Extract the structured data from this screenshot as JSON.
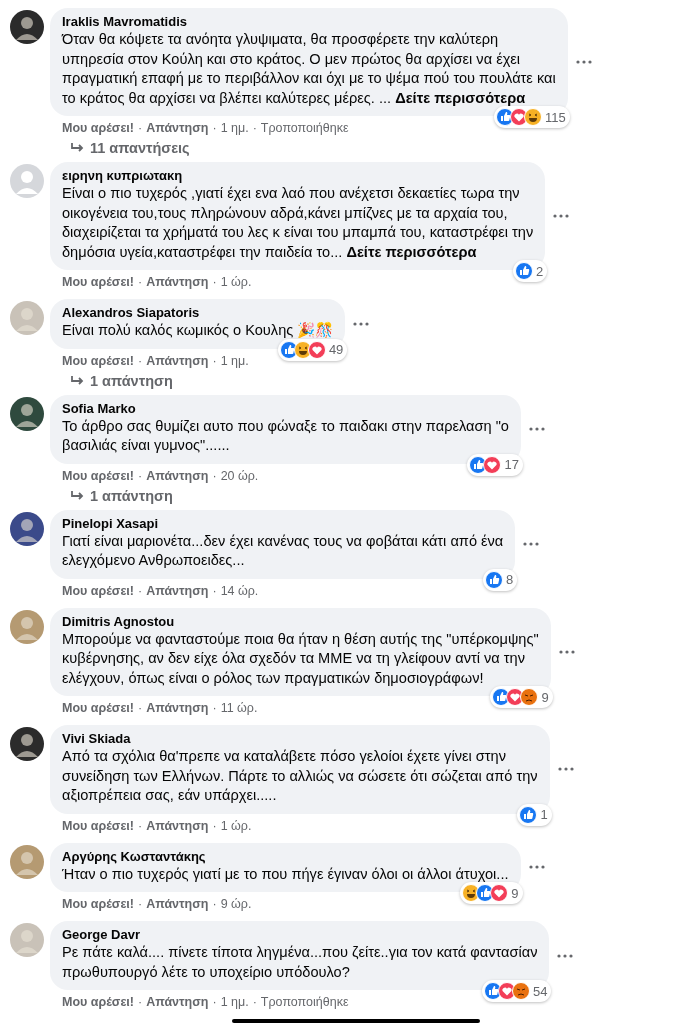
{
  "comments": [
    {
      "author": "Iraklis Mavromatidis",
      "lines": [
        "Όταν θα κόψετε τα ανόητα γλυψιματα, θα προσφέρετε την καλύτερη",
        "υπηρεσία στον Κούλη και στο κράτος. Ο μεν πρώτος θα αρχίσει να έχει",
        "πραγματική επαφή με το περιβάλλον και όχι με το ψέμα πού του πουλάτε και",
        "το κράτος θα αρχίσει να βλέπει καλύτερες μέρες. ... **Δείτε περισσότερα**"
      ],
      "actions": [
        {
          "kind": "like",
          "text": "Μου αρέσει!"
        },
        {
          "kind": "sep",
          "text": "·"
        },
        {
          "kind": "reply",
          "text": "Απάντηση"
        },
        {
          "kind": "sep",
          "text": "·"
        },
        {
          "kind": "meta",
          "text": "1 ημ."
        },
        {
          "kind": "sep",
          "text": "·"
        },
        {
          "kind": "meta",
          "text": "Τροποποιήθηκε"
        }
      ],
      "reactions": [
        {
          "kind": "like"
        },
        {
          "kind": "love"
        },
        {
          "kind": "haha"
        }
      ],
      "count": "115",
      "replies": "11 απαντήσεις"
    },
    {
      "author": "ειρηνη κυπριωτακη",
      "lines": [
        "Είναι ο πιο τυχερός ,γιατί έχει ενα λαό που ανέχετσι δεκαετίες τωρα την",
        "οικογένεια του,τους πληρώνουν αδρά,κάνει μπίζνες με τα αρχαία του,",
        "διαχειρίζεται τα χρήματά του λες κ είναι του μπαμπά του, καταστρέφει την",
        "δημόσια υγεία,καταστρέφει την παιδεία το... **Δείτε περισσότερα**"
      ],
      "actions": [
        {
          "kind": "like",
          "text": "Μου αρέσει!"
        },
        {
          "kind": "sep",
          "text": "·"
        },
        {
          "kind": "reply",
          "text": "Απάντηση"
        },
        {
          "kind": "sep",
          "text": "·"
        },
        {
          "kind": "meta",
          "text": "1 ώρ."
        }
      ],
      "reactions": [
        {
          "kind": "like"
        }
      ],
      "count": "2"
    },
    {
      "author": "Alexandros Siapatoris",
      "lines": [
        "Είναι πολύ καλός κωμικός ο Κουλης 🎉🎊"
      ],
      "actions": [
        {
          "kind": "like",
          "text": "Μου αρέσει!"
        },
        {
          "kind": "sep",
          "text": "·"
        },
        {
          "kind": "reply",
          "text": "Απάντηση"
        },
        {
          "kind": "sep",
          "text": "·"
        },
        {
          "kind": "meta",
          "text": "1 ημ."
        }
      ],
      "reactions": [
        {
          "kind": "like"
        },
        {
          "kind": "haha"
        },
        {
          "kind": "love"
        }
      ],
      "count": "49",
      "replies": "1 απάντηση"
    },
    {
      "author": "Sofia Marko",
      "lines": [
        "Το άρθρο σας θυμίζει αυτο που φώναξε το παιδακι στην παρελαση \"ο",
        "βασιλιάς είναι γυμνος\"......"
      ],
      "actions": [
        {
          "kind": "like",
          "text": "Μου αρέσει!"
        },
        {
          "kind": "sep",
          "text": "·"
        },
        {
          "kind": "reply",
          "text": "Απάντηση"
        },
        {
          "kind": "sep",
          "text": "·"
        },
        {
          "kind": "meta",
          "text": "20 ώρ."
        }
      ],
      "reactions": [
        {
          "kind": "like"
        },
        {
          "kind": "love"
        }
      ],
      "count": "17",
      "replies": "1 απάντηση"
    },
    {
      "author": "Pinelopi Xasapi",
      "lines": [
        "Γιατί είναι μαριονέτα...δεν έχει κανένας τους να φοβάται κάτι από ένα",
        "ελεγχόμενο Ανθρωποειδες..."
      ],
      "actions": [
        {
          "kind": "like",
          "text": "Μου αρέσει!"
        },
        {
          "kind": "sep",
          "text": "·"
        },
        {
          "kind": "reply",
          "text": "Απάντηση"
        },
        {
          "kind": "sep",
          "text": "·"
        },
        {
          "kind": "meta",
          "text": "14 ώρ."
        }
      ],
      "reactions": [
        {
          "kind": "like"
        }
      ],
      "count": "8"
    },
    {
      "author": "Dimitris Agnostou",
      "lines": [
        "Μπορούμε να φανταστούμε ποια θα ήταν η θέση αυτής της \"υπέρκομψης\"",
        "κυβέρνησης, αν δεν είχε όλα σχεδόν τα ΜΜΕ να τη γλείφουν αντί να την",
        "ελέγχουν, όπως είναι ο ρόλος των πραγματικών δημοσιογράφων!"
      ],
      "actions": [
        {
          "kind": "like",
          "text": "Μου αρέσει!"
        },
        {
          "kind": "sep",
          "text": "·"
        },
        {
          "kind": "reply",
          "text": "Απάντηση"
        },
        {
          "kind": "sep",
          "text": "·"
        },
        {
          "kind": "meta",
          "text": "11 ώρ."
        }
      ],
      "reactions": [
        {
          "kind": "like"
        },
        {
          "kind": "love"
        },
        {
          "kind": "angry"
        }
      ],
      "count": "9"
    },
    {
      "author": "Vivi Skiada",
      "lines": [
        "Από τα σχόλια θα'πρεπε να καταλάβετε πόσο γελοίοι έχετε γίνει στην",
        "συνείδηση των Ελλήνων. Πάρτε το αλλιώς να σώσετε ότι σώζεται από την",
        "αξιοπρέπεια σας, εάν υπάρχει....."
      ],
      "actions": [
        {
          "kind": "like",
          "text": "Μου αρέσει!"
        },
        {
          "kind": "sep",
          "text": "·"
        },
        {
          "kind": "reply",
          "text": "Απάντηση"
        },
        {
          "kind": "sep",
          "text": "·"
        },
        {
          "kind": "meta",
          "text": "1 ώρ."
        }
      ],
      "reactions": [
        {
          "kind": "like"
        }
      ],
      "count": "1"
    },
    {
      "author": "Αργύρης Κωσταντάκης",
      "lines": [
        "Ήταν ο πιο τυχερός γιατί με το που πήγε έγιναν όλοι οι άλλοι άτυχοι..."
      ],
      "actions": [
        {
          "kind": "like",
          "text": "Μου αρέσει!"
        },
        {
          "kind": "sep",
          "text": "·"
        },
        {
          "kind": "reply",
          "text": "Απάντηση"
        },
        {
          "kind": "sep",
          "text": "·"
        },
        {
          "kind": "meta",
          "text": "9 ώρ."
        }
      ],
      "reactions": [
        {
          "kind": "haha"
        },
        {
          "kind": "like"
        },
        {
          "kind": "love"
        }
      ],
      "count": "9"
    },
    {
      "author": "George Davr",
      "lines": [
        "Ρε πάτε καλά.... πίνετε τίποτα ληγμένα...που ζείτε..για τον κατά φαντασίαν",
        "πρωθυπουργό λέτε το υποχείριο υπόδουλο?"
      ],
      "actions": [
        {
          "kind": "like",
          "text": "Μου αρέσει!"
        },
        {
          "kind": "sep",
          "text": "·"
        },
        {
          "kind": "reply",
          "text": "Απάντηση"
        },
        {
          "kind": "sep",
          "text": "·"
        },
        {
          "kind": "meta",
          "text": "1 ημ."
        },
        {
          "kind": "sep",
          "text": "·"
        },
        {
          "kind": "meta",
          "text": "Τροποποιήθηκε"
        }
      ],
      "reactions": [
        {
          "kind": "like"
        },
        {
          "kind": "love"
        },
        {
          "kind": "angry"
        }
      ],
      "count": "54"
    }
  ]
}
